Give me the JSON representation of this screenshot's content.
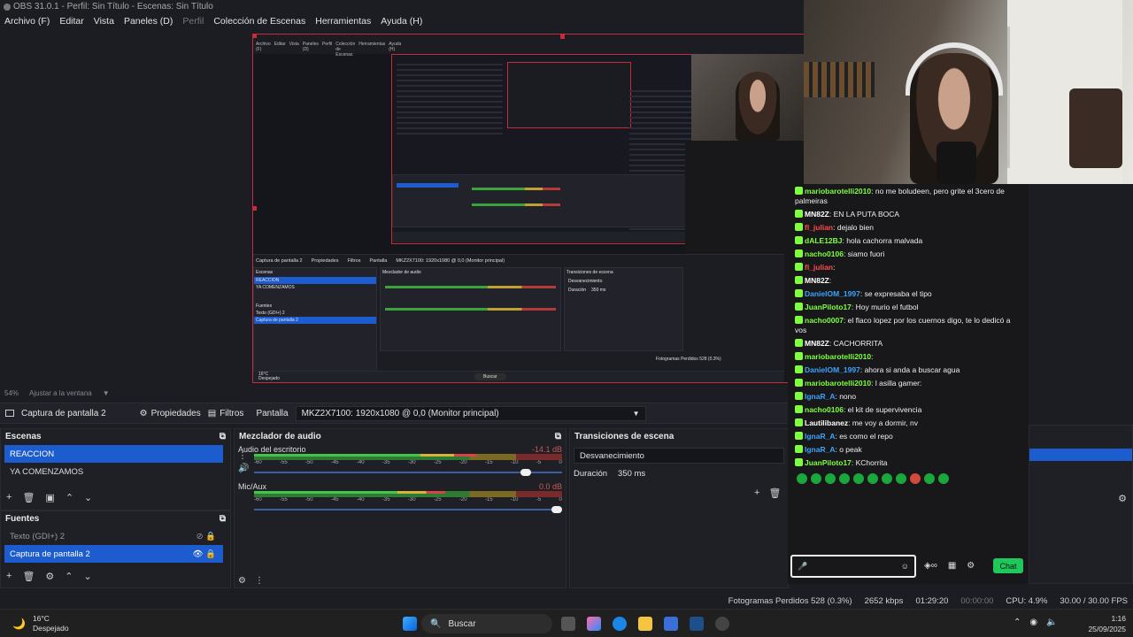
{
  "window": {
    "title": "OBS 31.0.1 - Perfil: Sin Título - Escenas: Sin Título"
  },
  "menu": {
    "items": [
      "Archivo (F)",
      "Editar",
      "Vista",
      "Paneles (D)",
      "Perfil",
      "Colección de Escenas",
      "Herramientas",
      "Ayuda (H)"
    ]
  },
  "preview_inner": {
    "menu": [
      "Archivo (F)",
      "Editar",
      "Vista",
      "Paneles (D)",
      "Perfil",
      "Colección de Escenas",
      "Herramientas",
      "Ayuda (H)"
    ],
    "source_label": "Captura de pantalla 2",
    "props": "Propiedades",
    "filters": "Filtros",
    "screen": "Pantalla",
    "monitor": "MKZ2X7100: 1920x1080 @ 0,0 (Monitor principal)",
    "scenes_title": "Escenas",
    "scene_sel": "REACCION",
    "scene_2": "YA COMENZAMOS",
    "sources_title": "Fuentes",
    "src_1": "Texto (GDI+) 2",
    "src_2": "Captura de pantalla 2",
    "mixer_title": "Mezclador de audio",
    "trans_title": "Transiciones de escena",
    "trans_value": "Desvanecimiento",
    "dur_label": "Duración",
    "dur_value": "350 ms",
    "search": "Buscar",
    "dropped": "Fotogramas Perdidos 528 (0.3%)",
    "weather_temp": "16°C",
    "weather_text": "Despejado"
  },
  "zoom": {
    "percent": "54%",
    "fit": "Ajustar a la ventana"
  },
  "toolbar": {
    "source": "Captura de pantalla 2",
    "properties": "Propiedades",
    "filters": "Filtros",
    "screen_label": "Pantalla",
    "monitor": "MKZ2X7100: 1920x1080 @ 0,0 (Monitor principal)"
  },
  "scenes": {
    "title": "Escenas",
    "items": [
      "REACCION",
      "YA COMENZAMOS"
    ],
    "selected": 0
  },
  "sources": {
    "title": "Fuentes",
    "items": [
      "Texto (GDI+) 2",
      "Captura de pantalla 2"
    ],
    "selected": 1
  },
  "mixer": {
    "title": "Mezclador de audio",
    "ticks": [
      "-60",
      "-55",
      "-50",
      "-45",
      "-40",
      "-35",
      "-30",
      "-25",
      "-20",
      "-15",
      "-10",
      "-5",
      "0"
    ],
    "channels": [
      {
        "name": "Audio del escritorio",
        "db": "-14.1 dB",
        "level": 0.72,
        "volume": 0.9
      },
      {
        "name": "Mic/Aux",
        "db": "0.0 dB",
        "level": 0.62,
        "volume": 1.0
      }
    ]
  },
  "transitions": {
    "title": "Transiciones de escena",
    "value": "Desvanecimiento",
    "duration_label": "Duración",
    "duration_value": "350 ms"
  },
  "chat": {
    "messages": [
      {
        "nick": "mariobarotelli2010",
        "color": "#7fff3f",
        "text": "no me boludeen, pero grite el 3cero de palmeiras"
      },
      {
        "nick": "MN82Z",
        "color": "#ffffff",
        "text": "EN LA PUTA BOCA"
      },
      {
        "nick": "fl_julian",
        "color": "#ff4a4a",
        "text": "dejalo bien"
      },
      {
        "nick": "dALE12BJ",
        "color": "#7fff3f",
        "text": "hola cachorra malvada"
      },
      {
        "nick": "nacho0106",
        "color": "#7fff3f",
        "text": "siamo fuori"
      },
      {
        "nick": "fl_julian",
        "color": "#ff4a4a",
        "text": ""
      },
      {
        "nick": "MN82Z",
        "color": "#ffffff",
        "text": ""
      },
      {
        "nick": "DanielOM_1997",
        "color": "#3aa3ff",
        "text": "se expresaba el tipo"
      },
      {
        "nick": "JuanPiloto17",
        "color": "#7fff3f",
        "text": "Hoy murio el futbol"
      },
      {
        "nick": "nacho0007",
        "color": "#7fff3f",
        "text": "el flaco lopez por los cuernos digo, te lo dedicó a vos"
      },
      {
        "nick": "MN82Z",
        "color": "#ffffff",
        "text": "CACHORRITA"
      },
      {
        "nick": "mariobarotelli2010",
        "color": "#7fff3f",
        "text": ""
      },
      {
        "nick": "DanielOM_1997",
        "color": "#3aa3ff",
        "text": "ahora si anda a buscar agua"
      },
      {
        "nick": "mariobarotelli2010",
        "color": "#7fff3f",
        "text": "l asilla gamer:"
      },
      {
        "nick": "IgnaR_A",
        "color": "#3aa3ff",
        "text": "nono"
      },
      {
        "nick": "nacho0106",
        "color": "#7fff3f",
        "text": "el kit de supervivencia"
      },
      {
        "nick": "Lautilibanez",
        "color": "#ffffff",
        "text": "me voy a dormir, nv"
      },
      {
        "nick": "IgnaR_A",
        "color": "#3aa3ff",
        "text": "es como el repo"
      },
      {
        "nick": "IgnaR_A",
        "color": "#3aa3ff",
        "text": "o peak"
      },
      {
        "nick": "JuanPiloto17",
        "color": "#7fff3f",
        "text": "KChorrita"
      }
    ],
    "send_label": "Chat"
  },
  "status": {
    "dropped": "Fotogramas Perdidos 528 (0.3%)",
    "bitrate": "2652 kbps",
    "live_time": "01:29:20",
    "rec_time": "00:00:00",
    "cpu": "CPU: 4.9%",
    "fps": "30.00 / 30.00 FPS"
  },
  "taskbar": {
    "weather_temp": "16°C",
    "weather_text": "Despejado",
    "search": "Buscar",
    "time": "1:16",
    "date": "25/09/2025"
  }
}
